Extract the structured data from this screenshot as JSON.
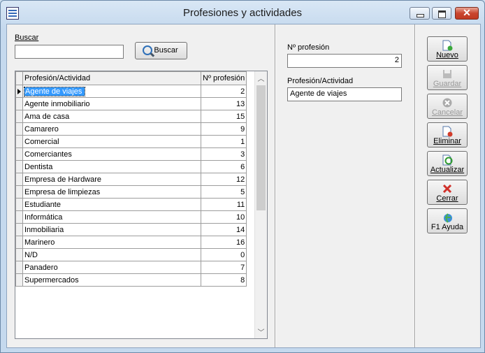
{
  "window": {
    "title": "Profesiones y actividades"
  },
  "search": {
    "label": "Buscar",
    "value": "",
    "button": "Buscar"
  },
  "grid": {
    "columns": [
      "Profesión/Actividad",
      "Nº profesión"
    ],
    "rows": [
      {
        "name": "Agente de viajes",
        "num": "2"
      },
      {
        "name": "Agente inmobiliario",
        "num": "13"
      },
      {
        "name": "Ama de casa",
        "num": "15"
      },
      {
        "name": "Camarero",
        "num": "9"
      },
      {
        "name": "Comercial",
        "num": "1"
      },
      {
        "name": "Comerciantes",
        "num": "3"
      },
      {
        "name": "Dentista",
        "num": "6"
      },
      {
        "name": "Empresa de Hardware",
        "num": "12"
      },
      {
        "name": "Empresa de limpiezas",
        "num": "5"
      },
      {
        "name": "Estudiante",
        "num": "11"
      },
      {
        "name": "Informática",
        "num": "10"
      },
      {
        "name": "Inmobiliaria",
        "num": "14"
      },
      {
        "name": "Marinero",
        "num": "16"
      },
      {
        "name": "N/D",
        "num": "0"
      },
      {
        "name": "Panadero",
        "num": "7"
      },
      {
        "name": "Supermercados",
        "num": "8"
      }
    ]
  },
  "detail": {
    "num_label": "Nº profesión",
    "num_value": "2",
    "name_label": "Profesión/Actividad",
    "name_value": "Agente de viajes"
  },
  "actions": {
    "nuevo": "Nuevo",
    "guardar": "Guardar",
    "cancelar": "Cancelar",
    "eliminar": "Eliminar",
    "actualizar": "Actualizar",
    "cerrar": "Cerrar",
    "ayuda": "F1 Ayuda"
  },
  "colors": {
    "selection": "#3399ff",
    "close": "#c9452f"
  }
}
